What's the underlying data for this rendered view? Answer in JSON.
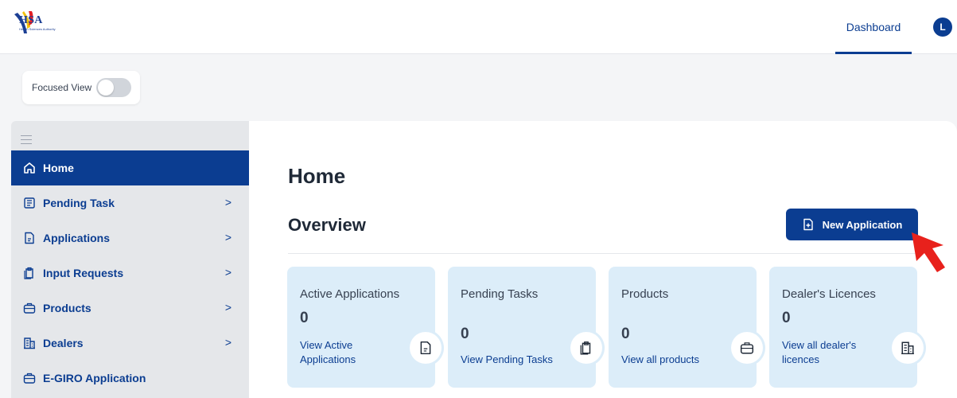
{
  "header": {
    "logo_text": "HSA",
    "logo_subtitle": "Health Sciences Authority",
    "nav": [
      {
        "label": "Dashboard",
        "active": true
      }
    ],
    "avatar_initial": "L"
  },
  "focused_view": {
    "label": "Focused View",
    "enabled": false
  },
  "sidebar": {
    "items": [
      {
        "label": "Home",
        "icon": "home-icon",
        "active": true,
        "has_chevron": false
      },
      {
        "label": "Pending Task",
        "icon": "task-icon",
        "has_chevron": true
      },
      {
        "label": "Applications",
        "icon": "document-icon",
        "has_chevron": true
      },
      {
        "label": "Input Requests",
        "icon": "clipboard-icon",
        "has_chevron": true
      },
      {
        "label": "Products",
        "icon": "briefcase-icon",
        "has_chevron": true
      },
      {
        "label": "Dealers",
        "icon": "building-icon",
        "has_chevron": true
      },
      {
        "label": "E-GIRO Application",
        "icon": "briefcase-icon",
        "has_chevron": false
      }
    ],
    "chevron": ">"
  },
  "main": {
    "title": "Home",
    "overview_title": "Overview",
    "new_application_label": "New Application",
    "cards": [
      {
        "title": "Active Applications",
        "count": "0",
        "link": "View Active Applications",
        "icon": "document-icon"
      },
      {
        "title": "Pending Tasks",
        "count": "0",
        "link": "View Pending Tasks",
        "icon": "clipboard-icon"
      },
      {
        "title": "Products",
        "count": "0",
        "link": "View all products",
        "icon": "briefcase-icon"
      },
      {
        "title": "Dealer's Licences",
        "count": "0",
        "link": "View all dealer's licences",
        "icon": "building-icon"
      }
    ]
  },
  "colors": {
    "primary": "#0b3d91",
    "card_bg": "#dcedf9",
    "sidebar_bg": "#e5e7ea",
    "cursor": "#e8211c"
  }
}
